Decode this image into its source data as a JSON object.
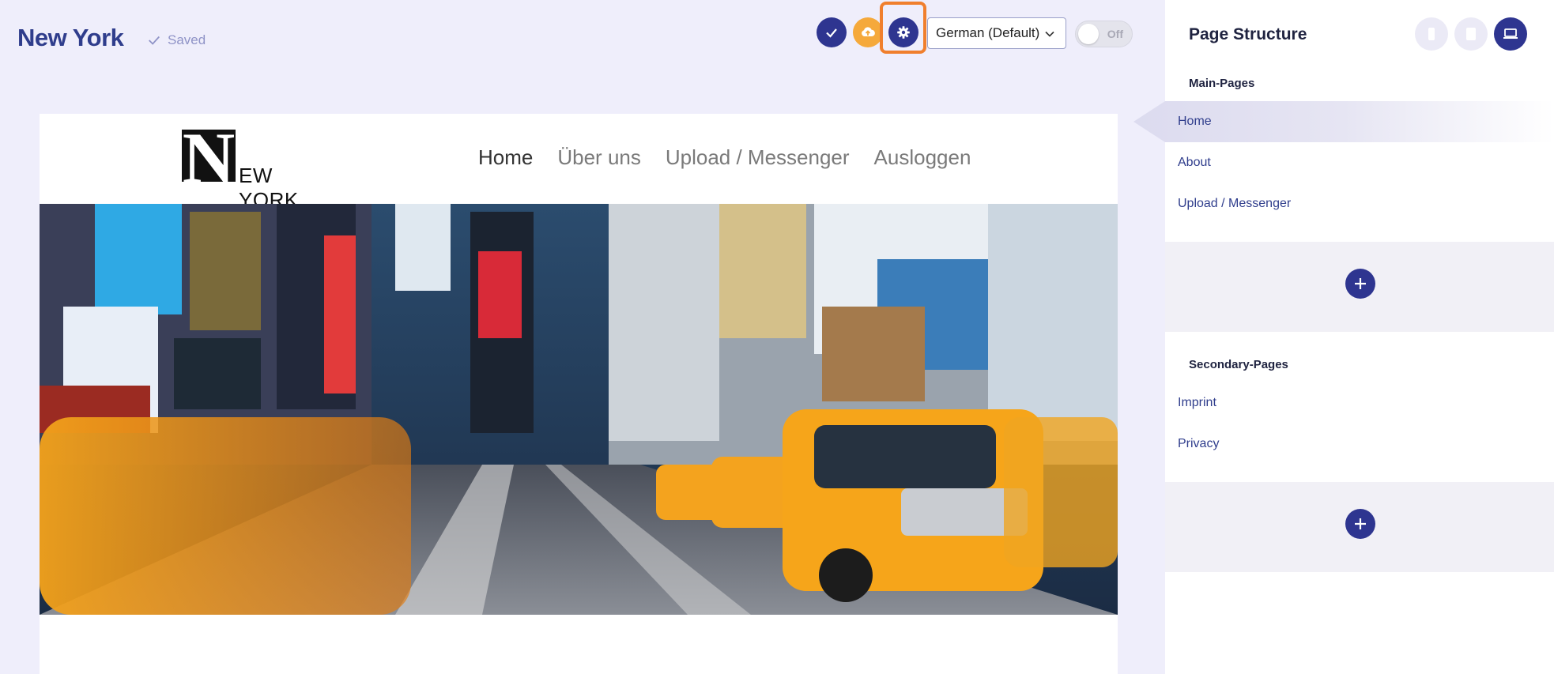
{
  "header": {
    "title": "New York",
    "saved_label": "Saved",
    "language": "German (Default)",
    "toggle_label": "Off",
    "icons": [
      "check-icon",
      "cloud-upload-icon",
      "gear-icon"
    ],
    "accent": "#2e3590",
    "highlight": "#f07f2d"
  },
  "preview": {
    "logo_initial": "N",
    "logo_rest": "EW YORK",
    "nav": [
      "Home",
      "Über uns",
      "Upload / Messenger",
      "Ausloggen"
    ]
  },
  "panel": {
    "title": "Page Structure",
    "device_buttons": [
      "mobile-icon",
      "tablet-icon",
      "desktop-icon"
    ],
    "main_title": "Main-Pages",
    "main_pages": [
      "Home",
      "About",
      "Upload / Messenger"
    ],
    "secondary_title": "Secondary-Pages",
    "secondary_pages": [
      "Imprint",
      "Privacy"
    ]
  }
}
